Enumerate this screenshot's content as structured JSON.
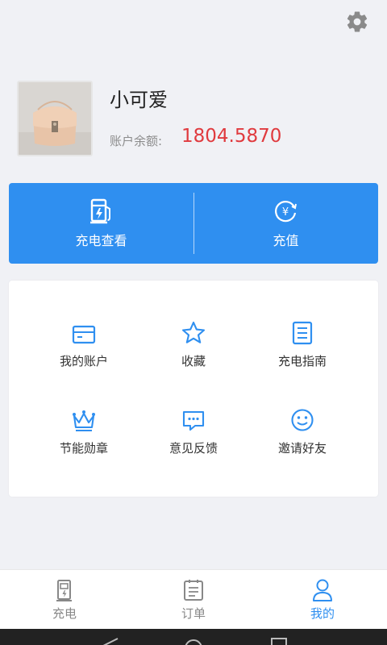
{
  "header": {
    "settings_icon": "gear-icon"
  },
  "profile": {
    "avatar_icon": "bag-photo",
    "name": "小可爱",
    "balance_label": "账户余额:",
    "balance_value": "1804.5870"
  },
  "quick_actions": [
    {
      "label": "充电查看",
      "icon": "charging-station-icon"
    },
    {
      "label": "充值",
      "icon": "yuan-recharge-icon"
    }
  ],
  "menu": [
    {
      "label": "我的账户",
      "icon": "card-icon"
    },
    {
      "label": "收藏",
      "icon": "star-icon"
    },
    {
      "label": "充电指南",
      "icon": "guide-icon"
    },
    {
      "label": "节能勋章",
      "icon": "crown-icon"
    },
    {
      "label": "意见反馈",
      "icon": "message-icon"
    },
    {
      "label": "邀请好友",
      "icon": "smile-icon"
    }
  ],
  "tabbar": [
    {
      "label": "充电",
      "icon": "charge-tab-icon",
      "active": false
    },
    {
      "label": "订单",
      "icon": "order-tab-icon",
      "active": false
    },
    {
      "label": "我的",
      "icon": "user-tab-icon",
      "active": true
    }
  ],
  "colors": {
    "primary": "#2f8ff0",
    "balance": "#e03a3e",
    "background": "#f0f1f5"
  }
}
